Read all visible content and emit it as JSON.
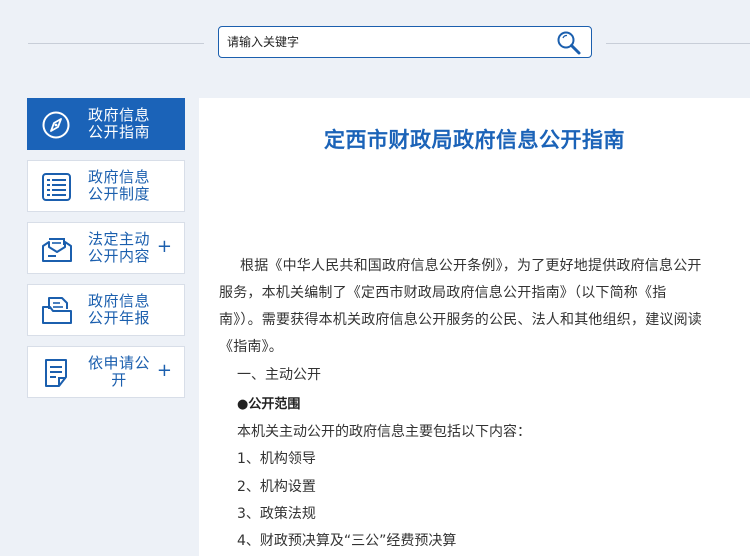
{
  "search": {
    "placeholder": "请输入关键字"
  },
  "sidebar": {
    "items": [
      {
        "label": "政府信息公开指南",
        "icon": "compass-icon",
        "plus": ""
      },
      {
        "label": "政府信息公开制度",
        "icon": "list-document-icon",
        "plus": ""
      },
      {
        "label": "法定主动公开内容",
        "icon": "envelope-icon",
        "plus": "+"
      },
      {
        "label": "政府信息公开年报",
        "icon": "folder-document-icon",
        "plus": ""
      },
      {
        "label": "依申请公开",
        "icon": "form-document-icon",
        "plus": "+"
      }
    ]
  },
  "colors": {
    "accent": "#1b63b8",
    "background": "#edf1f7"
  },
  "main": {
    "title": "定西市财政局政府信息公开指南",
    "intro": "根据《中华人民共和国政府信息公开条例》，为了更好地提供政府信息公开服务，本机关编制了《定西市财政局政府信息公开指南》（以下简称《指南》）。需要获得本机关政府信息公开服务的公民、法人和其他组织，建议阅读《指南》。",
    "section1": "一、主动公开",
    "scope_heading": "●公开范围",
    "scope_intro": "本机关主动公开的政府信息主要包括以下内容：",
    "list": [
      "1、机构领导",
      "2、机构设置",
      "3、政策法规",
      "4、财政预决算及“三公”经费预决算"
    ]
  }
}
